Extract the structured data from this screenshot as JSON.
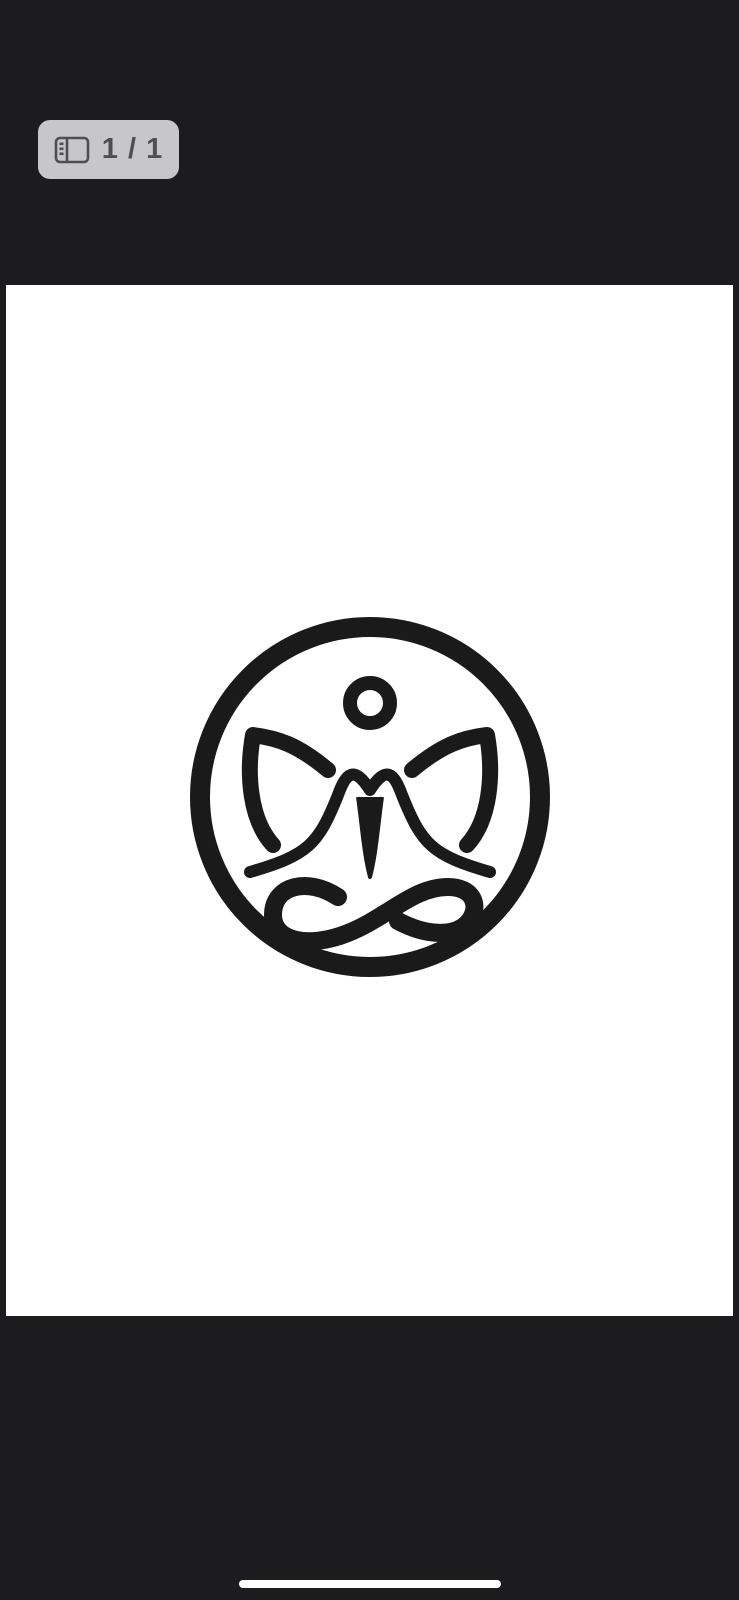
{
  "viewer": {
    "page_indicator": {
      "icon": "sidebar-icon",
      "count": "1 / 1"
    },
    "document_page": {
      "logo": "meditation-lotus-logo"
    }
  },
  "colors": {
    "background": "#1c1c1e",
    "page": "#ffffff",
    "indicator_bg": "#c7c7c9",
    "indicator_text": "#4f4f52",
    "logo": "#1a1a1a"
  }
}
